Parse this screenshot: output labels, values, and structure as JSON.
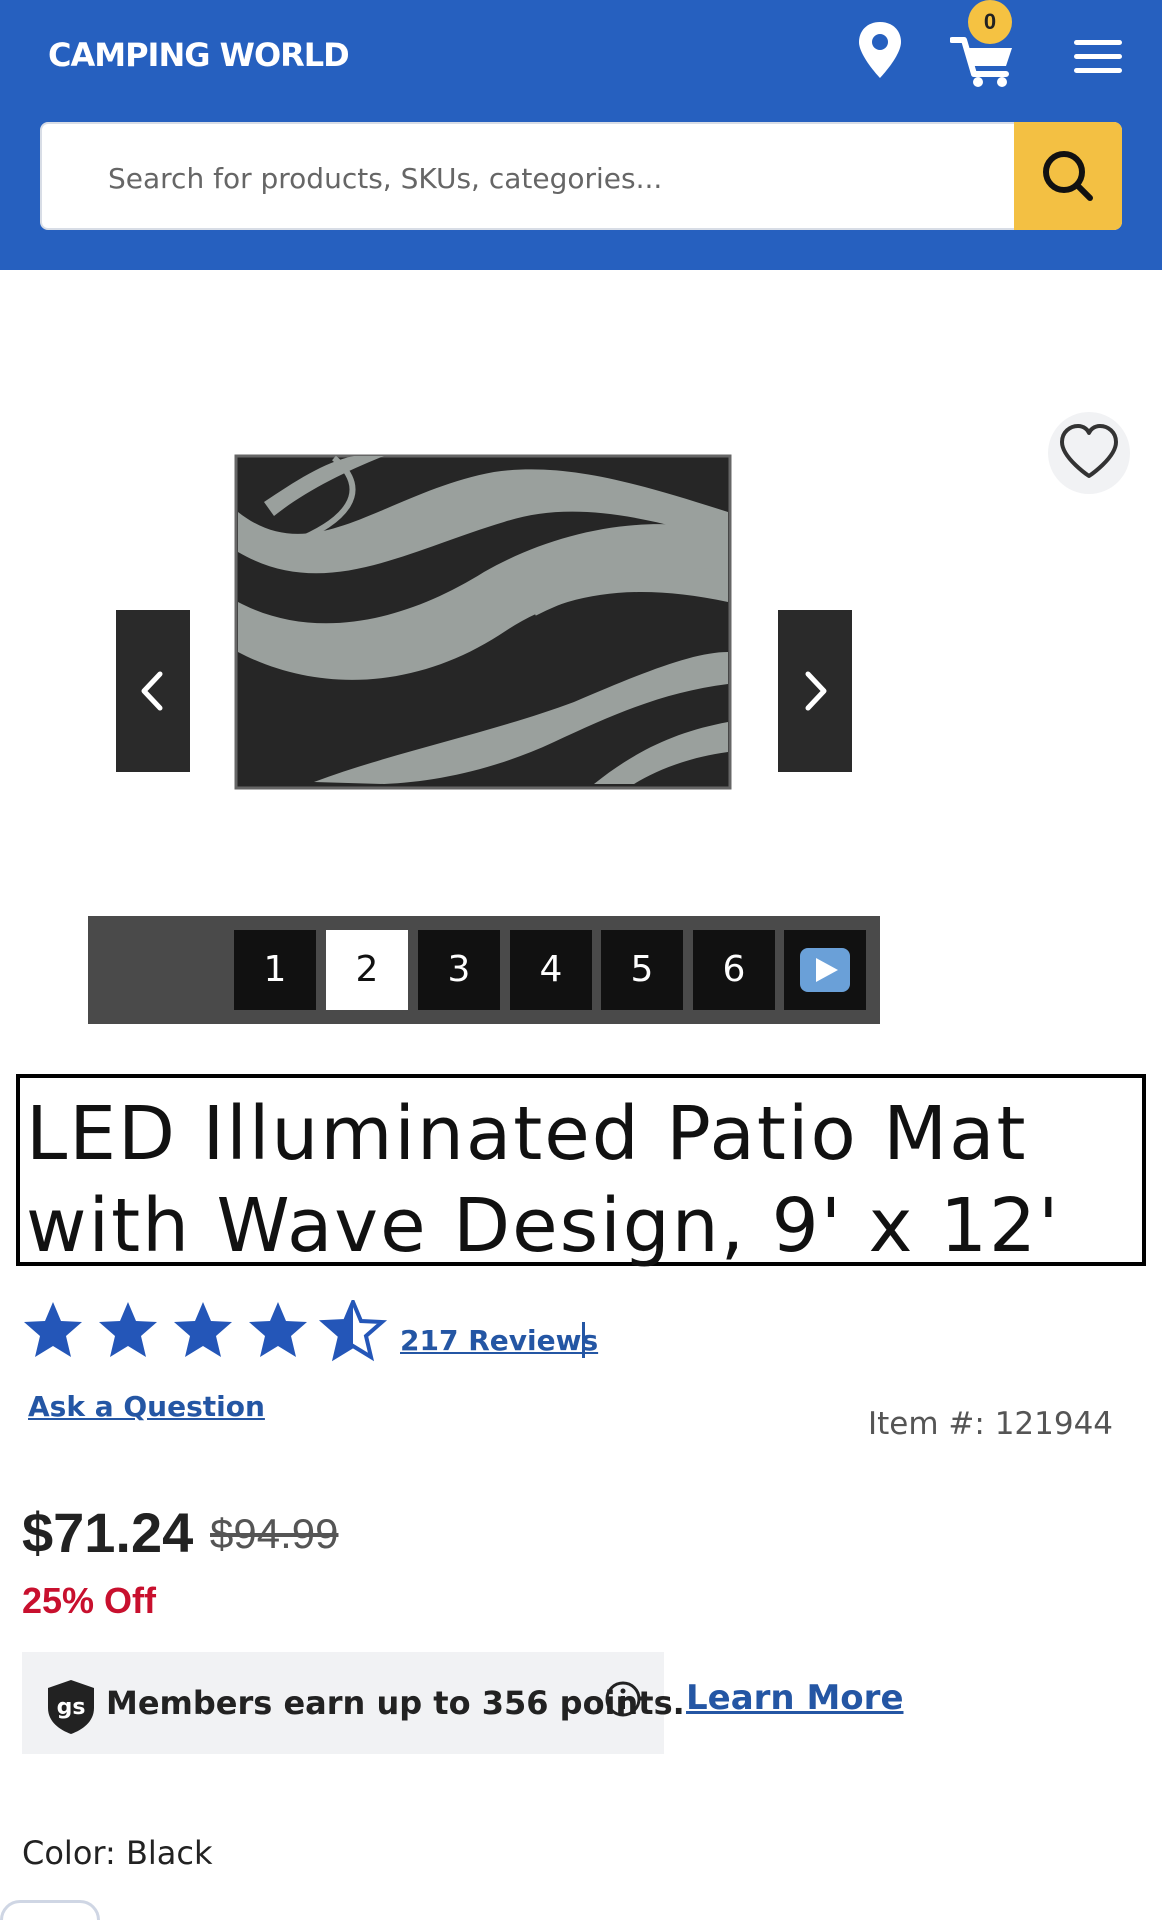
{
  "header": {
    "logo": "CAMPING WORLD",
    "cart_count": "0",
    "icons": [
      "location-pin-icon",
      "cart-icon",
      "hamburger-menu-icon"
    ],
    "colors": {
      "header_bg": "#2660bf",
      "search_button": "#f3c043",
      "badge": "#f5c242"
    }
  },
  "search": {
    "placeholder": "Search for products, SKUs, categories..."
  },
  "gallery": {
    "thumbnails": [
      "1",
      "2",
      "3",
      "4",
      "5",
      "6"
    ],
    "active_thumbnail": "2"
  },
  "product": {
    "title_line1": "LED Illuminated Patio Mat",
    "title_line2": "with Wave Design, 9' x 12'",
    "rating": 4.5,
    "reviews_link": "217 Reviews",
    "separator": "|",
    "ask_question": "Ask a Question",
    "item_number": "Item #: 121944",
    "price": "$71.24",
    "original_price": "$94.99",
    "discount": "25% Off",
    "color_label": "Color:",
    "color_value": "Black"
  },
  "rewards": {
    "badge": "gs",
    "text": "Members earn up to 356 points.",
    "learn_more": "Learn More"
  }
}
